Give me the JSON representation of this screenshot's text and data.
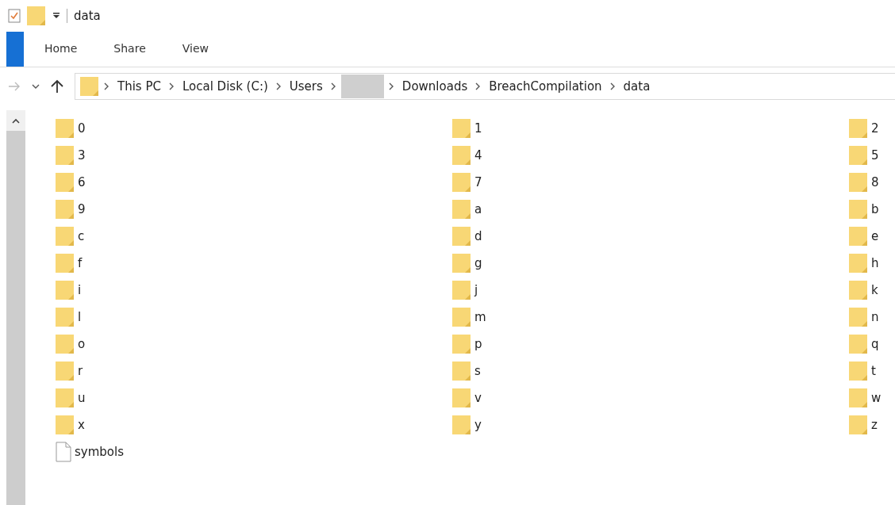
{
  "window": {
    "title": "data"
  },
  "ribbon": {
    "tabs": [
      {
        "label": "Home",
        "selected": false
      },
      {
        "label": "Share",
        "selected": false
      },
      {
        "label": "View",
        "selected": false
      }
    ]
  },
  "address_bar": {
    "crumbs": [
      {
        "kind": "text",
        "label": "This PC"
      },
      {
        "kind": "text",
        "label": "Local Disk (C:)"
      },
      {
        "kind": "text",
        "label": "Users"
      },
      {
        "kind": "redacted"
      },
      {
        "kind": "text",
        "label": "Downloads"
      },
      {
        "kind": "text",
        "label": "BreachCompilation"
      },
      {
        "kind": "text",
        "label": "data"
      }
    ]
  },
  "files": [
    {
      "name": "0",
      "kind": "folder"
    },
    {
      "name": "1",
      "kind": "folder"
    },
    {
      "name": "2",
      "kind": "folder"
    },
    {
      "name": "3",
      "kind": "folder"
    },
    {
      "name": "4",
      "kind": "folder"
    },
    {
      "name": "5",
      "kind": "folder"
    },
    {
      "name": "6",
      "kind": "folder"
    },
    {
      "name": "7",
      "kind": "folder"
    },
    {
      "name": "8",
      "kind": "folder"
    },
    {
      "name": "9",
      "kind": "folder"
    },
    {
      "name": "a",
      "kind": "folder"
    },
    {
      "name": "b",
      "kind": "folder"
    },
    {
      "name": "c",
      "kind": "folder"
    },
    {
      "name": "d",
      "kind": "folder"
    },
    {
      "name": "e",
      "kind": "folder"
    },
    {
      "name": "f",
      "kind": "folder"
    },
    {
      "name": "g",
      "kind": "folder"
    },
    {
      "name": "h",
      "kind": "folder"
    },
    {
      "name": "i",
      "kind": "folder"
    },
    {
      "name": "j",
      "kind": "folder"
    },
    {
      "name": "k",
      "kind": "folder"
    },
    {
      "name": "l",
      "kind": "folder"
    },
    {
      "name": "m",
      "kind": "folder"
    },
    {
      "name": "n",
      "kind": "folder"
    },
    {
      "name": "o",
      "kind": "folder"
    },
    {
      "name": "p",
      "kind": "folder"
    },
    {
      "name": "q",
      "kind": "folder"
    },
    {
      "name": "r",
      "kind": "folder"
    },
    {
      "name": "s",
      "kind": "folder"
    },
    {
      "name": "t",
      "kind": "folder"
    },
    {
      "name": "u",
      "kind": "folder"
    },
    {
      "name": "v",
      "kind": "folder"
    },
    {
      "name": "w",
      "kind": "folder"
    },
    {
      "name": "x",
      "kind": "folder"
    },
    {
      "name": "y",
      "kind": "folder"
    },
    {
      "name": "z",
      "kind": "folder"
    },
    {
      "name": "symbols",
      "kind": "file"
    }
  ]
}
